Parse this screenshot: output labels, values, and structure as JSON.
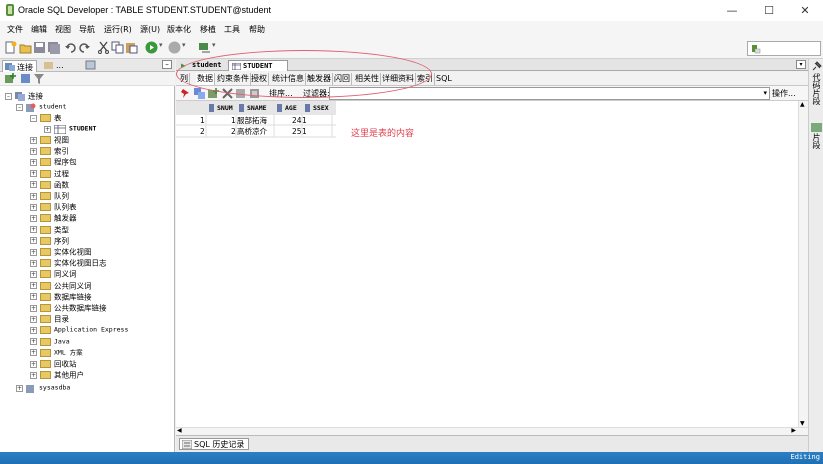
{
  "window": {
    "title": "Oracle SQL Developer : TABLE STUDENT.STUDENT@student",
    "minimize": "—",
    "maximize": "☐",
    "close": "✕"
  },
  "menu": [
    "文件",
    "编辑",
    "视图",
    "导航",
    "运行(R)",
    "源(U)",
    "版本化",
    "移植",
    "工具",
    "帮助"
  ],
  "left_tabs": {
    "connections": "连接",
    "reports": "..."
  },
  "tree": {
    "root": "连接",
    "conn": "student",
    "tables": "表",
    "table_student": "STUDENT",
    "items": [
      "视图",
      "索引",
      "程序包",
      "过程",
      "函数",
      "队列",
      "队列表",
      "触发器",
      "类型",
      "序列",
      "实体化视图",
      "实体化视图日志",
      "同义词",
      "公共同义词",
      "数据库链接",
      "公共数据库链接",
      "目录",
      "Application Express",
      "Java",
      "XML 方案",
      "回收站",
      "其他用户"
    ],
    "sys": "sysasdba"
  },
  "doc_tabs": [
    "student",
    "STUDENT"
  ],
  "sub_tabs": [
    "列",
    "数据",
    "约束条件",
    "授权",
    "统计信息",
    "触发器",
    "闪回",
    "相关性",
    "详细资料",
    "索引",
    "SQL"
  ],
  "data_toolbar": {
    "sort": "排序...",
    "filter": "过滤器:",
    "filter_value": "",
    "actions": "操作..."
  },
  "grid": {
    "columns": [
      "SNUM",
      "SNAME",
      "AGE",
      "SSEX"
    ],
    "rows": [
      [
        "1",
        "1",
        "服部拓海",
        "24",
        "1"
      ],
      [
        "2",
        "2",
        "高桥凉介",
        "25",
        "1"
      ]
    ]
  },
  "annotation": "这里是表的内容",
  "history_tab": "SQL 历史记录",
  "right_strip": [
    "代码片段",
    "片段"
  ],
  "status": "Editing",
  "colors": {
    "status_bar": "#1e6fb3",
    "annotation_red": "#e04050",
    "accent": "#3c6fb5"
  }
}
